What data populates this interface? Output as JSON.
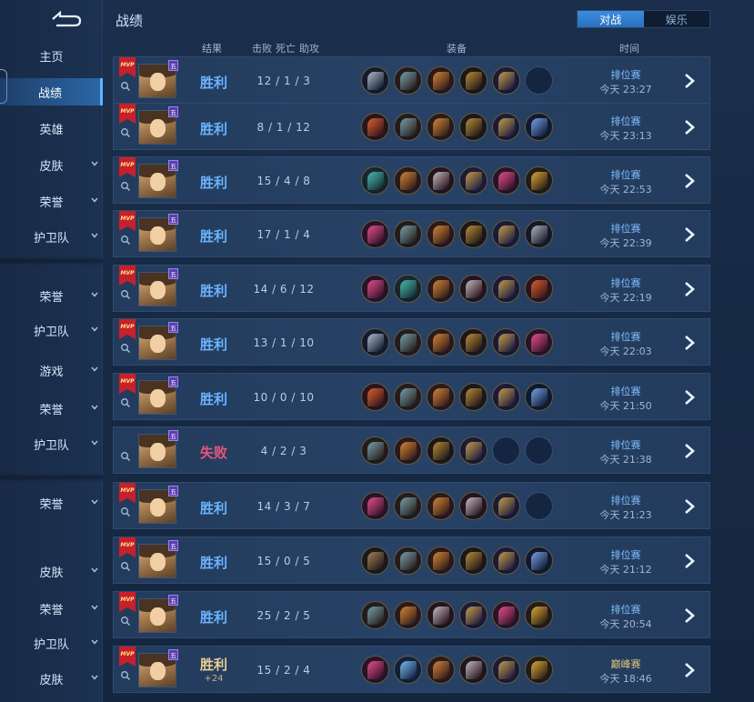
{
  "header": {
    "title": "战绩",
    "mode_tabs": [
      {
        "label": "对战",
        "active": true
      },
      {
        "label": "娱乐",
        "active": false
      }
    ]
  },
  "columns": {
    "result": "结果",
    "kills": "击败",
    "deaths": "死亡",
    "assists": "助攻",
    "equipment": "装备",
    "time": "时间"
  },
  "sidebar": {
    "items": [
      {
        "label": "主页",
        "chevron": false,
        "active": false
      },
      {
        "label": "战绩",
        "chevron": false,
        "active": true
      },
      {
        "label": "英雄",
        "chevron": false,
        "active": false
      },
      {
        "label": "皮肤",
        "chevron": true,
        "active": false
      },
      {
        "label": "荣誉",
        "chevron": true,
        "active": false
      },
      {
        "label": "护卫队",
        "chevron": true,
        "active": false
      },
      {
        "label": "荣誉",
        "chevron": true,
        "active": false
      },
      {
        "label": "护卫队",
        "chevron": true,
        "active": false
      },
      {
        "label": "游戏",
        "chevron": true,
        "active": false
      },
      {
        "label": "荣誉",
        "chevron": true,
        "active": false
      },
      {
        "label": "护卫队",
        "chevron": true,
        "active": false
      },
      {
        "label": "荣誉",
        "chevron": true,
        "active": false
      },
      {
        "label": "皮肤",
        "chevron": true,
        "active": false
      },
      {
        "label": "荣誉",
        "chevron": true,
        "active": false
      },
      {
        "label": "护卫队",
        "chevron": true,
        "active": false
      },
      {
        "label": "皮肤",
        "chevron": true,
        "active": false
      }
    ]
  },
  "rank_badge": "五",
  "mvp_label": "MVP",
  "colors": {
    "win": "#6bb4ff",
    "lose": "#e8557c",
    "peak": "#e6c77f",
    "accent": "#3b8de0"
  },
  "matches": [
    {
      "result": "胜利",
      "outcome": "win",
      "mvp": true,
      "kda": "12 / 1 / 3",
      "mode": "排位赛",
      "time": "今天 23:27",
      "items": [
        "dagger",
        "boots",
        "sword",
        "bow",
        "star",
        "empty"
      ]
    },
    {
      "result": "胜利",
      "outcome": "win",
      "mvp": true,
      "kda": "8 / 1 / 12",
      "mode": "排位赛",
      "time": "今天 23:13",
      "items": [
        "axe",
        "boots",
        "sword",
        "bow",
        "star",
        "halberd"
      ]
    },
    {
      "result": "胜利",
      "outcome": "win",
      "mvp": true,
      "kda": "15 / 4 / 8",
      "mode": "排位赛",
      "time": "今天 22:53",
      "items": [
        "teal-boots",
        "sword",
        "claw",
        "star",
        "pink-blade",
        "gold-wing"
      ]
    },
    {
      "result": "胜利",
      "outcome": "win",
      "mvp": true,
      "kda": "17 / 1 / 4",
      "mode": "排位赛",
      "time": "今天 22:39",
      "items": [
        "pink-blade",
        "boots",
        "sword",
        "bow",
        "star",
        "spear"
      ]
    },
    {
      "result": "胜利",
      "outcome": "win",
      "mvp": true,
      "kda": "14 / 6 / 12",
      "mode": "排位赛",
      "time": "今天 22:19",
      "items": [
        "pink-blade",
        "teal-boots",
        "sword",
        "claw",
        "star",
        "axe"
      ]
    },
    {
      "result": "胜利",
      "outcome": "win",
      "mvp": true,
      "kda": "13 / 1 / 10",
      "mode": "排位赛",
      "time": "今天 22:03",
      "items": [
        "dagger",
        "boots",
        "sword",
        "bow",
        "star",
        "pink-blade"
      ]
    },
    {
      "result": "胜利",
      "outcome": "win",
      "mvp": true,
      "kda": "10 / 0 / 10",
      "mode": "排位赛",
      "time": "今天 21:50",
      "items": [
        "axe",
        "boots",
        "sword",
        "bow",
        "star",
        "halberd"
      ]
    },
    {
      "result": "失败",
      "outcome": "lose",
      "mvp": false,
      "kda": "4 / 2 / 3",
      "mode": "排位赛",
      "time": "今天 21:38",
      "items": [
        "boots",
        "sword",
        "bow",
        "star",
        "empty",
        "empty"
      ]
    },
    {
      "result": "胜利",
      "outcome": "win",
      "mvp": true,
      "kda": "14 / 3 / 7",
      "mode": "排位赛",
      "time": "今天 21:23",
      "items": [
        "pink-blade",
        "boots",
        "sword",
        "claw",
        "star",
        "empty"
      ]
    },
    {
      "result": "胜利",
      "outcome": "win",
      "mvp": true,
      "kda": "15 / 0 / 5",
      "mode": "排位赛",
      "time": "今天 21:12",
      "items": [
        "gauntlet",
        "boots",
        "sword",
        "bow",
        "star",
        "halberd"
      ]
    },
    {
      "result": "胜利",
      "outcome": "win",
      "mvp": true,
      "kda": "25 / 2 / 5",
      "mode": "排位赛",
      "time": "今天 20:54",
      "items": [
        "boots",
        "sword",
        "claw",
        "star",
        "pink-blade",
        "gold-wing"
      ]
    },
    {
      "result": "胜利",
      "sub": "+24",
      "outcome": "peak",
      "mvp": true,
      "kda": "15 / 2 / 4",
      "mode": "巅峰赛",
      "time": "今天 18:46",
      "items": [
        "pink-blade",
        "ice-shield",
        "sword",
        "claw",
        "star",
        "gold-wing"
      ]
    }
  ]
}
